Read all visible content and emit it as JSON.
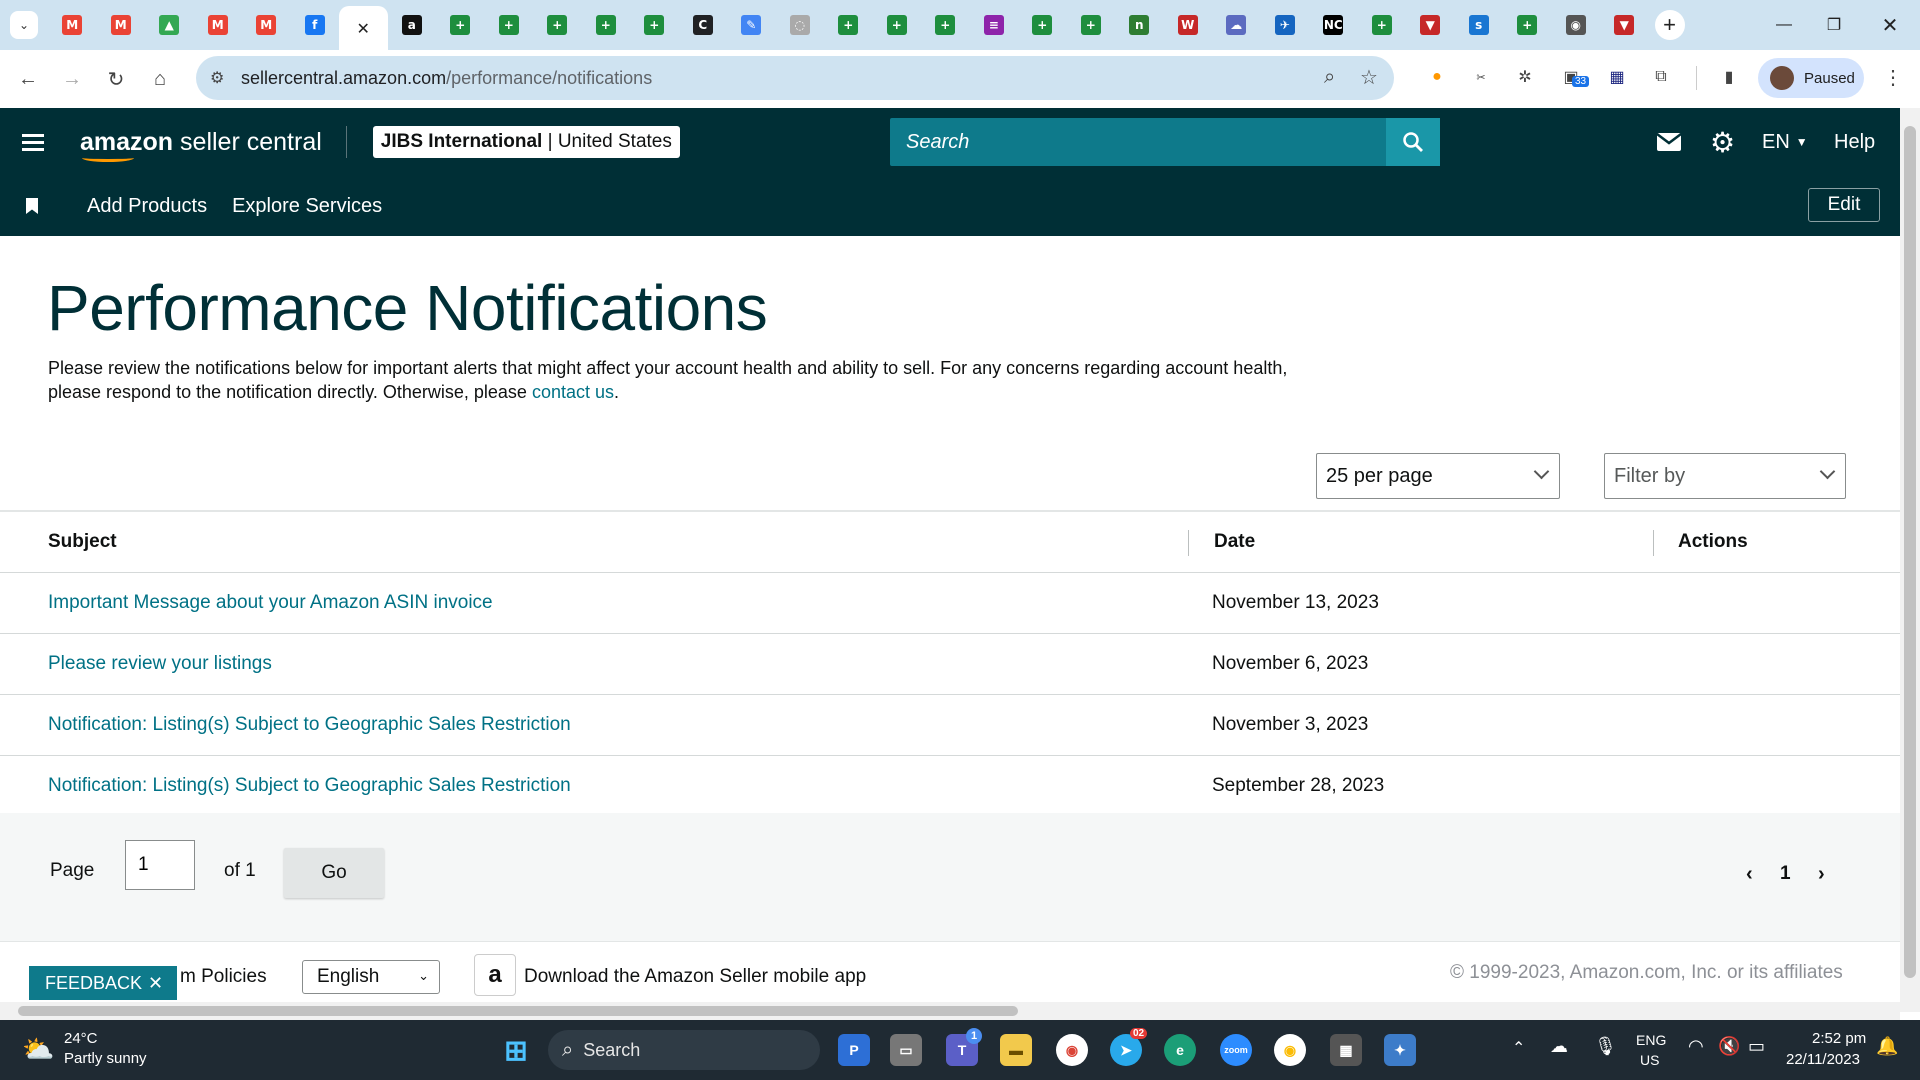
{
  "browser": {
    "active_tab_close": "✕",
    "url_host": "sellercentral.amazon.com",
    "url_path": "/performance/notifications",
    "profile_label": "Paused",
    "extension_badge": "33",
    "tabs": [
      {
        "icon": "gmail-icon",
        "glyph": "M",
        "color": "#ea4335"
      },
      {
        "icon": "gmail-icon",
        "glyph": "M",
        "color": "#ea4335"
      },
      {
        "icon": "google-drive-icon",
        "glyph": "▲",
        "color": "#34a853"
      },
      {
        "icon": "gmail-icon",
        "glyph": "M",
        "color": "#ea4335"
      },
      {
        "icon": "gmail-icon",
        "glyph": "M",
        "color": "#ea4335"
      },
      {
        "icon": "facebook-icon",
        "glyph": "f",
        "color": "#1877f2"
      },
      {
        "icon": "active-tab-close",
        "glyph": "✕",
        "color": "#ffffff"
      },
      {
        "icon": "amazon-icon",
        "glyph": "a",
        "color": "#111111"
      },
      {
        "icon": "sheets-icon",
        "glyph": "+",
        "color": "#1e8e3e"
      },
      {
        "icon": "sheets-icon",
        "glyph": "+",
        "color": "#1e8e3e"
      },
      {
        "icon": "sheets-icon",
        "glyph": "+",
        "color": "#1e8e3e"
      },
      {
        "icon": "sheets-icon",
        "glyph": "+",
        "color": "#1e8e3e"
      },
      {
        "icon": "sheets-icon",
        "glyph": "+",
        "color": "#1e8e3e"
      },
      {
        "icon": "circle-c-icon",
        "glyph": "C",
        "color": "#202124"
      },
      {
        "icon": "pencil-icon",
        "glyph": "✎",
        "color": "#4285f4"
      },
      {
        "icon": "globe-icon",
        "glyph": "◌",
        "color": "#aaaaaa"
      },
      {
        "icon": "sheets-icon",
        "glyph": "+",
        "color": "#1e8e3e"
      },
      {
        "icon": "sheets-icon",
        "glyph": "+",
        "color": "#1e8e3e"
      },
      {
        "icon": "sheets-icon",
        "glyph": "+",
        "color": "#1e8e3e"
      },
      {
        "icon": "purple-circle-icon",
        "glyph": "≡",
        "color": "#8e24aa"
      },
      {
        "icon": "sheets-icon",
        "glyph": "+",
        "color": "#1e8e3e"
      },
      {
        "icon": "sheets-icon",
        "glyph": "+",
        "color": "#1e8e3e"
      },
      {
        "icon": "n-logo-icon",
        "glyph": "n",
        "color": "#2e7d32"
      },
      {
        "icon": "ww-icon",
        "glyph": "W",
        "color": "#c62828"
      },
      {
        "icon": "cloud-icon",
        "glyph": "☁",
        "color": "#5c6bc0"
      },
      {
        "icon": "bird-icon",
        "glyph": "✈",
        "color": "#1565c0"
      },
      {
        "icon": "nc-icon",
        "glyph": "NC",
        "color": "#000000"
      },
      {
        "icon": "sheets-icon",
        "glyph": "+",
        "color": "#1e8e3e"
      },
      {
        "icon": "shield-icon",
        "glyph": "▼",
        "color": "#c62828"
      },
      {
        "icon": "sysco-icon",
        "glyph": "s",
        "color": "#1976d2"
      },
      {
        "icon": "sheets-icon",
        "glyph": "+",
        "color": "#1e8e3e"
      },
      {
        "icon": "badge-icon",
        "glyph": "◉",
        "color": "#555555"
      },
      {
        "icon": "shield-icon",
        "glyph": "▼",
        "color": "#c62828"
      }
    ]
  },
  "header": {
    "logo_brand": "amazon",
    "logo_suffix": "seller central",
    "account_name": "JIBS International",
    "account_region": "United States",
    "search_placeholder": "Search",
    "language": "EN",
    "help": "Help"
  },
  "subnav": {
    "items": [
      "Add Products",
      "Explore Services"
    ],
    "edit": "Edit"
  },
  "page": {
    "title": "Performance Notifications",
    "description": "Please review the notifications below for important alerts that might affect your account health and ability to sell. For any concerns regarding account health, please respond to the notification directly. Otherwise, please ",
    "contact_link": "contact us",
    "description_end": ".",
    "per_page": "25 per page",
    "filter_by": "Filter by"
  },
  "table": {
    "headers": {
      "subject": "Subject",
      "date": "Date",
      "actions": "Actions"
    },
    "rows": [
      {
        "subject": "Important Message about your Amazon ASIN invoice",
        "date": "November 13, 2023"
      },
      {
        "subject": "Please review your listings",
        "date": "November 6, 2023"
      },
      {
        "subject": "Notification: Listing(s) Subject to Geographic Sales Restriction",
        "date": "November 3, 2023"
      },
      {
        "subject": "Notification: Listing(s) Subject to Geographic Sales Restriction",
        "date": "September 28, 2023"
      }
    ]
  },
  "pagination": {
    "page_label": "Page",
    "page_value": "1",
    "of_label": "of 1",
    "go": "Go",
    "current": "1"
  },
  "footer": {
    "feedback": "FEEDBACK",
    "policies_fragment": "m Policies",
    "language_select": "English",
    "app_download": "Download the Amazon Seller mobile app",
    "copyright": "© 1999-2023, Amazon.com, Inc. or its affiliates"
  },
  "taskbar": {
    "weather_temp": "24°C",
    "weather_desc": "Partly sunny",
    "search": "Search",
    "teams_badge": "1",
    "telegram_badge": "02",
    "lang_top": "ENG",
    "lang_bottom": "US",
    "time": "2:52 pm",
    "date": "22/11/2023"
  },
  "colors": {
    "header_bg": "#002f36",
    "search_bg": "#0e7a8b",
    "link": "#007185",
    "tabstrip": "#cfe3f1"
  }
}
